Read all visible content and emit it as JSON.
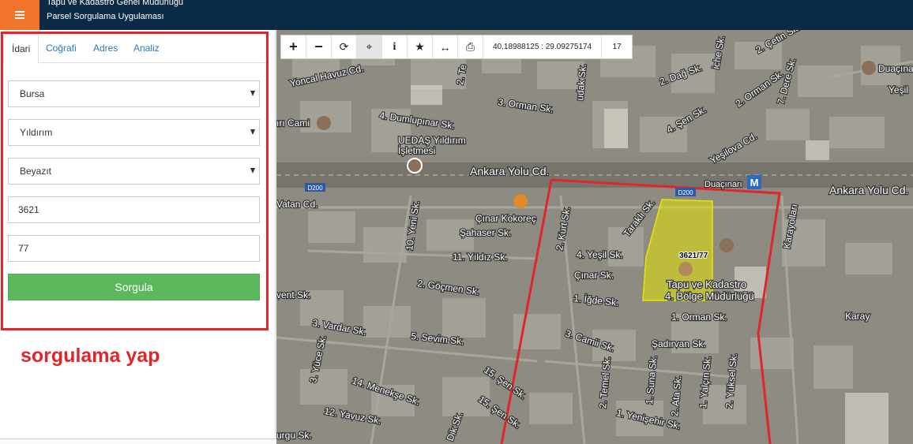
{
  "header": {
    "title_line1": "Tapu ve Kadastro Genel Müdürlüğü",
    "title_line2": "Parsel Sorgulama Uygulaması",
    "menu_icon": "hamburger-icon"
  },
  "tabs": [
    {
      "label": "İdari"
    },
    {
      "label": "Coğrafi"
    },
    {
      "label": "Adres"
    },
    {
      "label": "Analiz"
    }
  ],
  "form": {
    "province": "Bursa",
    "district": "Yıldırım",
    "neighborhood": "Beyazıt",
    "block": "3621",
    "parcel": "77",
    "submit_label": "Sorgula"
  },
  "annotation": "sorgulama yap",
  "toolbar": {
    "buttons": [
      "zoom-in-icon",
      "zoom-out-icon",
      "refresh-icon",
      "locate-icon",
      "info-icon",
      "star-icon",
      "measure-icon",
      "print-icon"
    ],
    "coordinates": "40.18988125 : 29.09275174",
    "zoom_level": "17"
  },
  "map": {
    "parcel_label": "3621/77",
    "labels": [
      "Yoncal Havuz Cd.",
      "ırı Cami",
      "4. Dumlupınar Sk.",
      "UEDAŞ Yıldırım",
      "İşletmesi",
      "3. Orman Sk.",
      "Ankara Yolu Cd.",
      "D200",
      "Duaçınarı",
      "Vatan Cd.",
      "Çınar Kokoreç",
      "Şahaser Sk.",
      "11. Yıldız Sk.",
      "2. Göçmen Sk.",
      "10. Yeni Sk.",
      "2. Kurt Sk.",
      "4. Yeşil Sk.",
      "Çınar Sk.",
      "1. İğde Sk.",
      "Taraklı Sk.",
      "Tapu ve Kadastro",
      "4. Bölge Müdürlüğü",
      "1. Orman Sk.",
      "Şadırvan Sk.",
      "3. Camii Sk.",
      "5. Sevim Sk.",
      "15. Şen Sk.",
      "3. Vardar Sk.",
      "14. Menekşe Sk.",
      "12. Yavuz Sk.",
      "3. Yüce Sk.",
      "1. Suna Sk.",
      "2. Temel Sk.",
      "1. Yenişehir Sk.",
      "2. Ata Sk.",
      "1. Yalçın Sk.",
      "2. Yüksel Sk.",
      "Karayolları",
      "2. Dağ Sk.",
      "4. Şen Sk.",
      "Yeşilova Cd.",
      "2. Çetin Sk.",
      "7. Dere Sk.",
      "Duaçına",
      "Yeşil",
      "2. Orman Sk.",
      "Ankara Yolu Cd.",
      "D200",
      "vent Sk.",
      "urgu Sk.",
      "Dik Sk.",
      "15. Şen Sk.",
      "iche Sk.",
      "udak Sk.",
      "2. Te",
      "Karay"
    ]
  },
  "colors": {
    "header_bg": "#0b2a45",
    "menu_accent": "#f0752a",
    "outline_red": "#e2252b",
    "submit_green": "#5cb85c",
    "parcel_fill": "#e6e600"
  }
}
